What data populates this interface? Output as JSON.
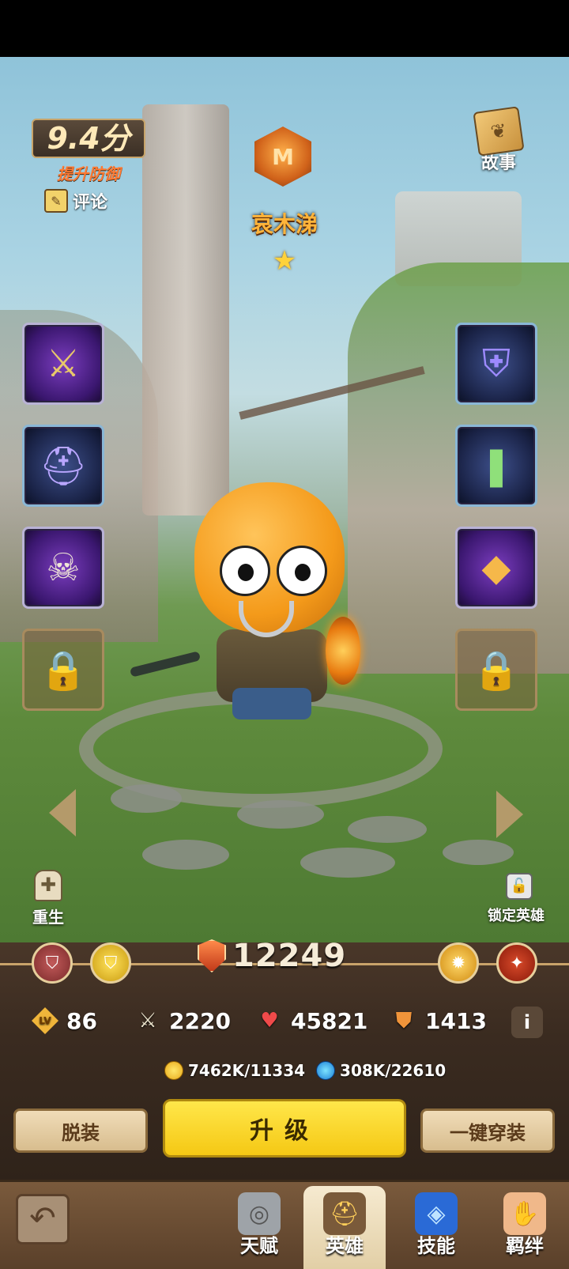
{
  "rating": {
    "score": "9.4分",
    "hint": "提升防御"
  },
  "comment_label": "评论",
  "story_label": "故事",
  "hero": {
    "name": "哀木涕",
    "stars": 1
  },
  "equipment": {
    "left": [
      "sword-icon",
      "helmet-icon",
      "skull-staff-icon",
      "lock-icon"
    ],
    "right": [
      "armor-icon",
      "boots-icon",
      "necklace-icon",
      "lock-icon"
    ]
  },
  "rebirth_label": "重生",
  "lock_hero_label": "锁定英雄",
  "power": "12249",
  "stats": {
    "level": "86",
    "attack": "2220",
    "hp": "45821",
    "defense": "1413"
  },
  "lv_badge": "LV",
  "info_button": "i",
  "resources": {
    "gold": "7462K/11334",
    "exp": "308K/22610"
  },
  "buttons": {
    "unequip": "脱装",
    "upgrade": "升级",
    "equip_all": "一键穿装"
  },
  "tabs": [
    {
      "label": "天赋",
      "active": false
    },
    {
      "label": "英雄",
      "active": true
    },
    {
      "label": "技能",
      "active": false
    },
    {
      "label": "羁绊",
      "active": false
    }
  ],
  "colors": {
    "upgrade": "#f5c814",
    "hero_name": "#ffb43a",
    "panel": "#3a2b20"
  }
}
